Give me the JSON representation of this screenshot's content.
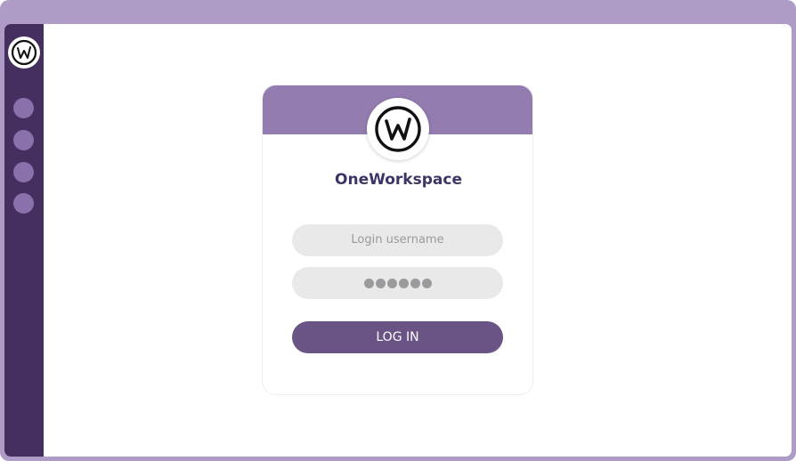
{
  "sidebar": {
    "logo_icon": "w-logo-icon",
    "nav_items": [
      {
        "icon": "circle-nav-icon"
      },
      {
        "icon": "circle-nav-icon"
      },
      {
        "icon": "circle-nav-icon"
      },
      {
        "icon": "circle-nav-icon"
      }
    ]
  },
  "login": {
    "logo_icon": "w-logo-icon",
    "app_name": "OneWorkspace",
    "username_placeholder": "Login username",
    "password_mask": "●●●●●●",
    "button_label": "LOG IN"
  },
  "colors": {
    "frame": "#ae9cc6",
    "sidebar": "#452f5f",
    "sidebar_dot": "#8a71ac",
    "card_header": "#937caf",
    "app_name": "#3e3567",
    "field_bg": "#e9e9ea",
    "button": "#6a5485"
  }
}
